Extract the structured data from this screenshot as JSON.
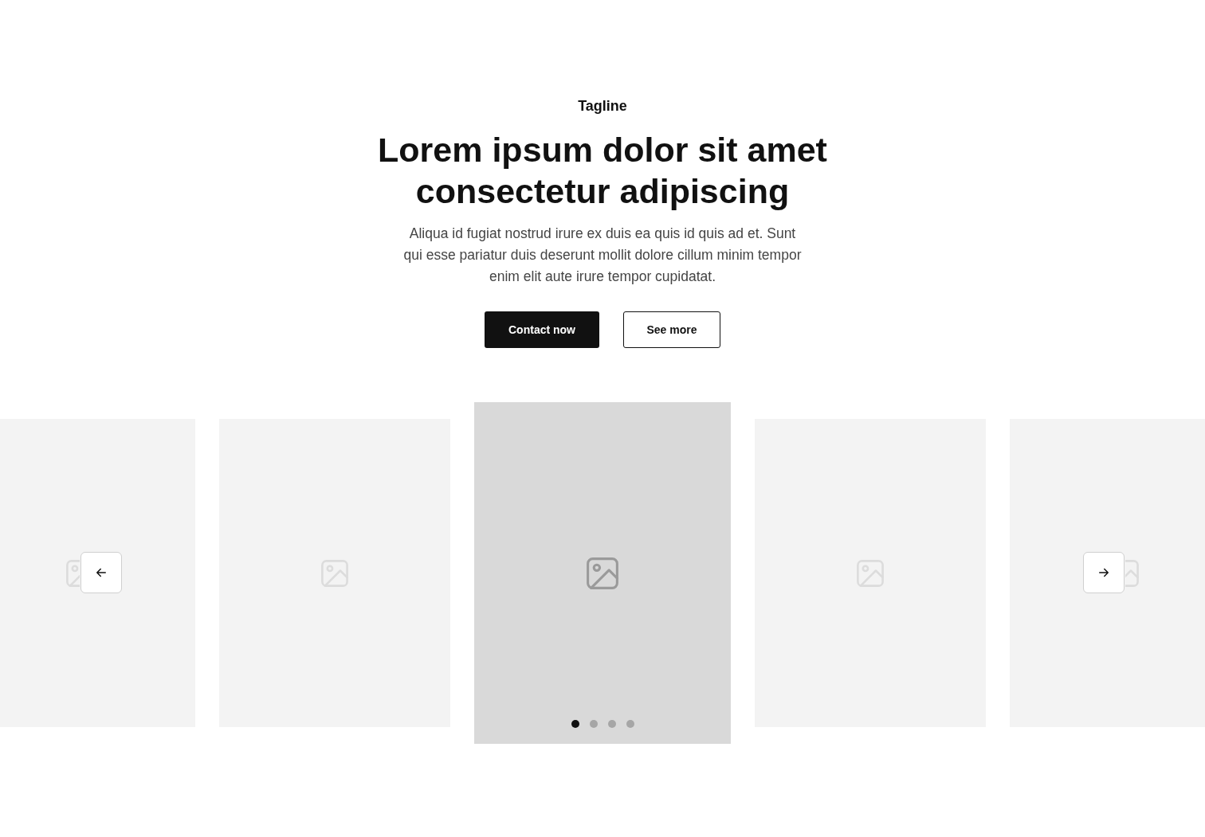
{
  "tagline": "Tagline",
  "heading": "Lorem ipsum dolor sit amet consectetur adipiscing",
  "description": "Aliqua id fugiat nostrud irure ex duis ea quis id quis ad et. Sunt qui esse pariatur duis deserunt mollit dolore cillum minim tempor enim elit aute irure tempor cupidatat.",
  "buttons": [
    {
      "label": "Contact now",
      "kind": "primary"
    },
    {
      "label": "See more",
      "kind": "secondary"
    }
  ],
  "slides": [
    {
      "selected": false
    },
    {
      "selected": false
    },
    {
      "selected": true
    },
    {
      "selected": false
    },
    {
      "selected": false
    }
  ],
  "dots": [
    {
      "selected": true
    },
    {
      "selected": false
    },
    {
      "selected": false
    },
    {
      "selected": false
    }
  ]
}
